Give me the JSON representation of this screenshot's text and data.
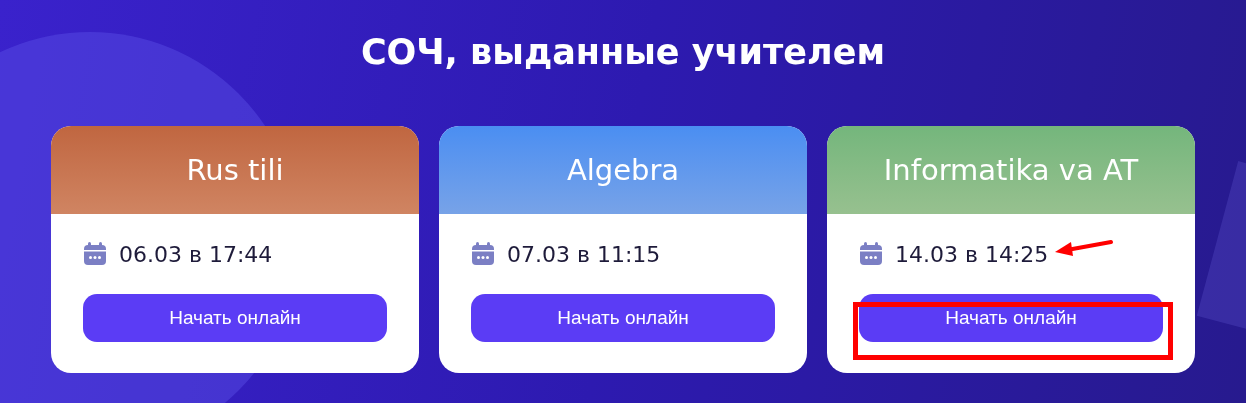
{
  "title": "СОЧ, выданные учителем",
  "cards": [
    {
      "subject": "Rus tili",
      "color": "#c06640",
      "date": "06.03 в 17:44",
      "button": "Начать онлайн",
      "highlighted": false,
      "pointer_arrow": false
    },
    {
      "subject": "Algebra",
      "color": "#4a8ef2",
      "date": "07.03 в 11:15",
      "button": "Начать онлайн",
      "highlighted": false,
      "pointer_arrow": false
    },
    {
      "subject": "Informatika va AT",
      "color": "#74b67c",
      "date": "14.03 в 14:25",
      "button": "Начать онлайн",
      "highlighted": true,
      "pointer_arrow": true
    }
  ]
}
